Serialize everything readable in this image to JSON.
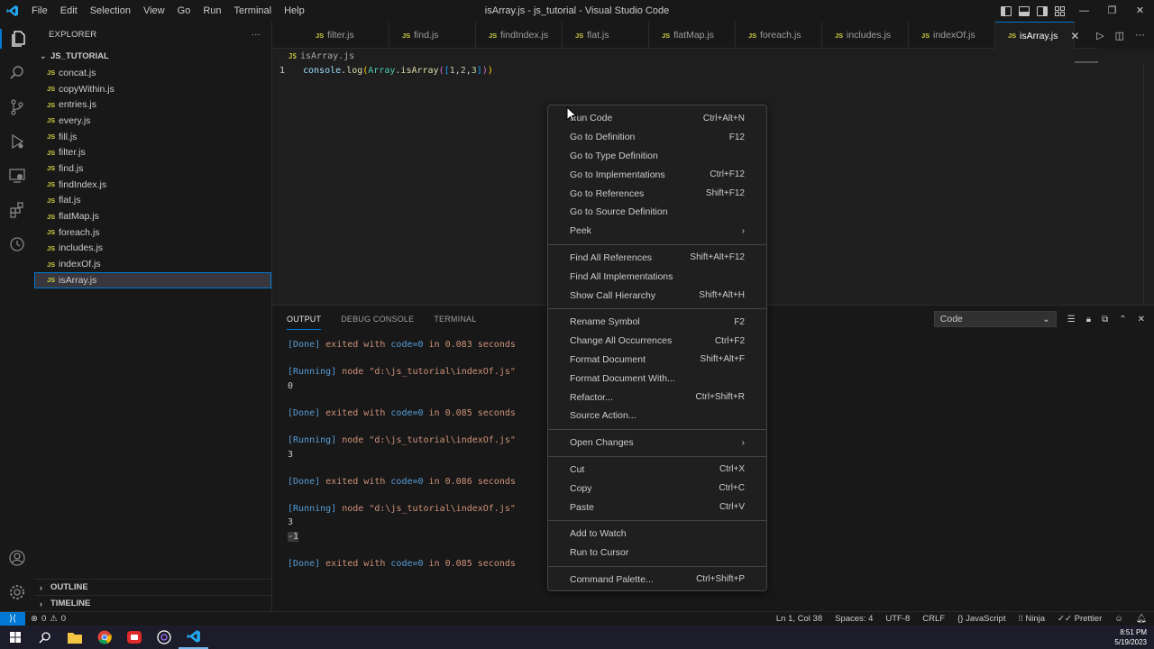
{
  "titlebar": {
    "menu": [
      "File",
      "Edit",
      "Selection",
      "View",
      "Go",
      "Run",
      "Terminal",
      "Help"
    ],
    "title": "isArray.js - js_tutorial - Visual Studio Code",
    "minimize": "—",
    "restore": "❐",
    "close": "✕"
  },
  "sidebar": {
    "header": "EXPLORER",
    "more": "···",
    "folder": "JS_TUTORIAL",
    "files": [
      "concat.js",
      "copyWithin.js",
      "entries.js",
      "every.js",
      "fill.js",
      "filter.js",
      "find.js",
      "findIndex.js",
      "flat.js",
      "flatMap.js",
      "foreach.js",
      "includes.js",
      "indexOf.js",
      "isArray.js"
    ],
    "active_file": "isArray.js",
    "outline": "OUTLINE",
    "timeline": "TIMELINE"
  },
  "tabs": [
    {
      "label": "filter.js",
      "active": false
    },
    {
      "label": "find.js",
      "active": false
    },
    {
      "label": "findIndex.js",
      "active": false
    },
    {
      "label": "flat.js",
      "active": false
    },
    {
      "label": "flatMap.js",
      "active": false
    },
    {
      "label": "foreach.js",
      "active": false
    },
    {
      "label": "includes.js",
      "active": false
    },
    {
      "label": "indexOf.js",
      "active": false
    },
    {
      "label": "isArray.js",
      "active": true
    }
  ],
  "editor": {
    "breadcrumb": "isArray.js",
    "line_number": "1",
    "code": {
      "obj": "console",
      "dot1": ".",
      "fn": "log",
      "p1": "(",
      "cls": "Array",
      "dot2": ".",
      "fn2": "isArray",
      "p2": "(",
      "b1": "[",
      "n1": "1",
      "c1": ", ",
      "n2": "2",
      "c2": ", ",
      "n3": "3",
      "b2": "]",
      "p3": ")",
      "p4": ")"
    }
  },
  "panel": {
    "tabs": [
      "OUTPUT",
      "DEBUG CONSOLE",
      "TERMINAL"
    ],
    "active_tab": "OUTPUT",
    "channel": "Code",
    "output": [
      {
        "type": "done",
        "text": "exited with ",
        "code": "code=0",
        "rest": " in 0.083 seconds"
      },
      {
        "type": "blank"
      },
      {
        "type": "running",
        "cmd": "node",
        "path": "\"d:\\js_tutorial\\indexOf.js\""
      },
      {
        "type": "value",
        "text": "0"
      },
      {
        "type": "blank"
      },
      {
        "type": "done",
        "text": "exited with ",
        "code": "code=0",
        "rest": " in 0.085 seconds"
      },
      {
        "type": "blank"
      },
      {
        "type": "running",
        "cmd": "node",
        "path": "\"d:\\js_tutorial\\indexOf.js\""
      },
      {
        "type": "value",
        "text": "3"
      },
      {
        "type": "blank"
      },
      {
        "type": "done",
        "text": "exited with ",
        "code": "code=0",
        "rest": " in 0.086 seconds"
      },
      {
        "type": "blank"
      },
      {
        "type": "running",
        "cmd": "node",
        "path": "\"d:\\js_tutorial\\indexOf.js\""
      },
      {
        "type": "value",
        "text": "3"
      },
      {
        "type": "neg",
        "text": "-1"
      },
      {
        "type": "blank"
      },
      {
        "type": "done",
        "text": "exited with ",
        "code": "code=0",
        "rest": " in 0.085 seconds"
      }
    ],
    "done_label": "[Done]",
    "running_label": "[Running]"
  },
  "context_menu": {
    "groups": [
      [
        {
          "label": "Run Code",
          "shortcut": "Ctrl+Alt+N"
        },
        {
          "label": "Go to Definition",
          "shortcut": "F12"
        },
        {
          "label": "Go to Type Definition",
          "shortcut": ""
        },
        {
          "label": "Go to Implementations",
          "shortcut": "Ctrl+F12"
        },
        {
          "label": "Go to References",
          "shortcut": "Shift+F12"
        },
        {
          "label": "Go to Source Definition",
          "shortcut": ""
        },
        {
          "label": "Peek",
          "shortcut": "",
          "submenu": true
        }
      ],
      [
        {
          "label": "Find All References",
          "shortcut": "Shift+Alt+F12"
        },
        {
          "label": "Find All Implementations",
          "shortcut": ""
        },
        {
          "label": "Show Call Hierarchy",
          "shortcut": "Shift+Alt+H"
        }
      ],
      [
        {
          "label": "Rename Symbol",
          "shortcut": "F2"
        },
        {
          "label": "Change All Occurrences",
          "shortcut": "Ctrl+F2"
        },
        {
          "label": "Format Document",
          "shortcut": "Shift+Alt+F"
        },
        {
          "label": "Format Document With...",
          "shortcut": ""
        },
        {
          "label": "Refactor...",
          "shortcut": "Ctrl+Shift+R"
        },
        {
          "label": "Source Action...",
          "shortcut": ""
        }
      ],
      [
        {
          "label": "Open Changes",
          "shortcut": "",
          "submenu": true
        }
      ],
      [
        {
          "label": "Cut",
          "shortcut": "Ctrl+X"
        },
        {
          "label": "Copy",
          "shortcut": "Ctrl+C"
        },
        {
          "label": "Paste",
          "shortcut": "Ctrl+V"
        }
      ],
      [
        {
          "label": "Add to Watch",
          "shortcut": ""
        },
        {
          "label": "Run to Cursor",
          "shortcut": ""
        }
      ],
      [
        {
          "label": "Command Palette...",
          "shortcut": "Ctrl+Shift+P"
        }
      ]
    ]
  },
  "statusbar": {
    "errors": "0",
    "warnings": "0",
    "position": "Ln 1, Col 38",
    "spaces": "Spaces: 4",
    "encoding": "UTF-8",
    "eol": "CRLF",
    "language": "JavaScript",
    "ninja": "Ninja",
    "prettier": "Prettier"
  },
  "taskbar": {
    "time": "8:51 PM",
    "date": "5/19/2023"
  },
  "colors": {
    "accent": "#0078d4",
    "js_icon": "#cbcb41",
    "background": "#1e1e1e"
  }
}
